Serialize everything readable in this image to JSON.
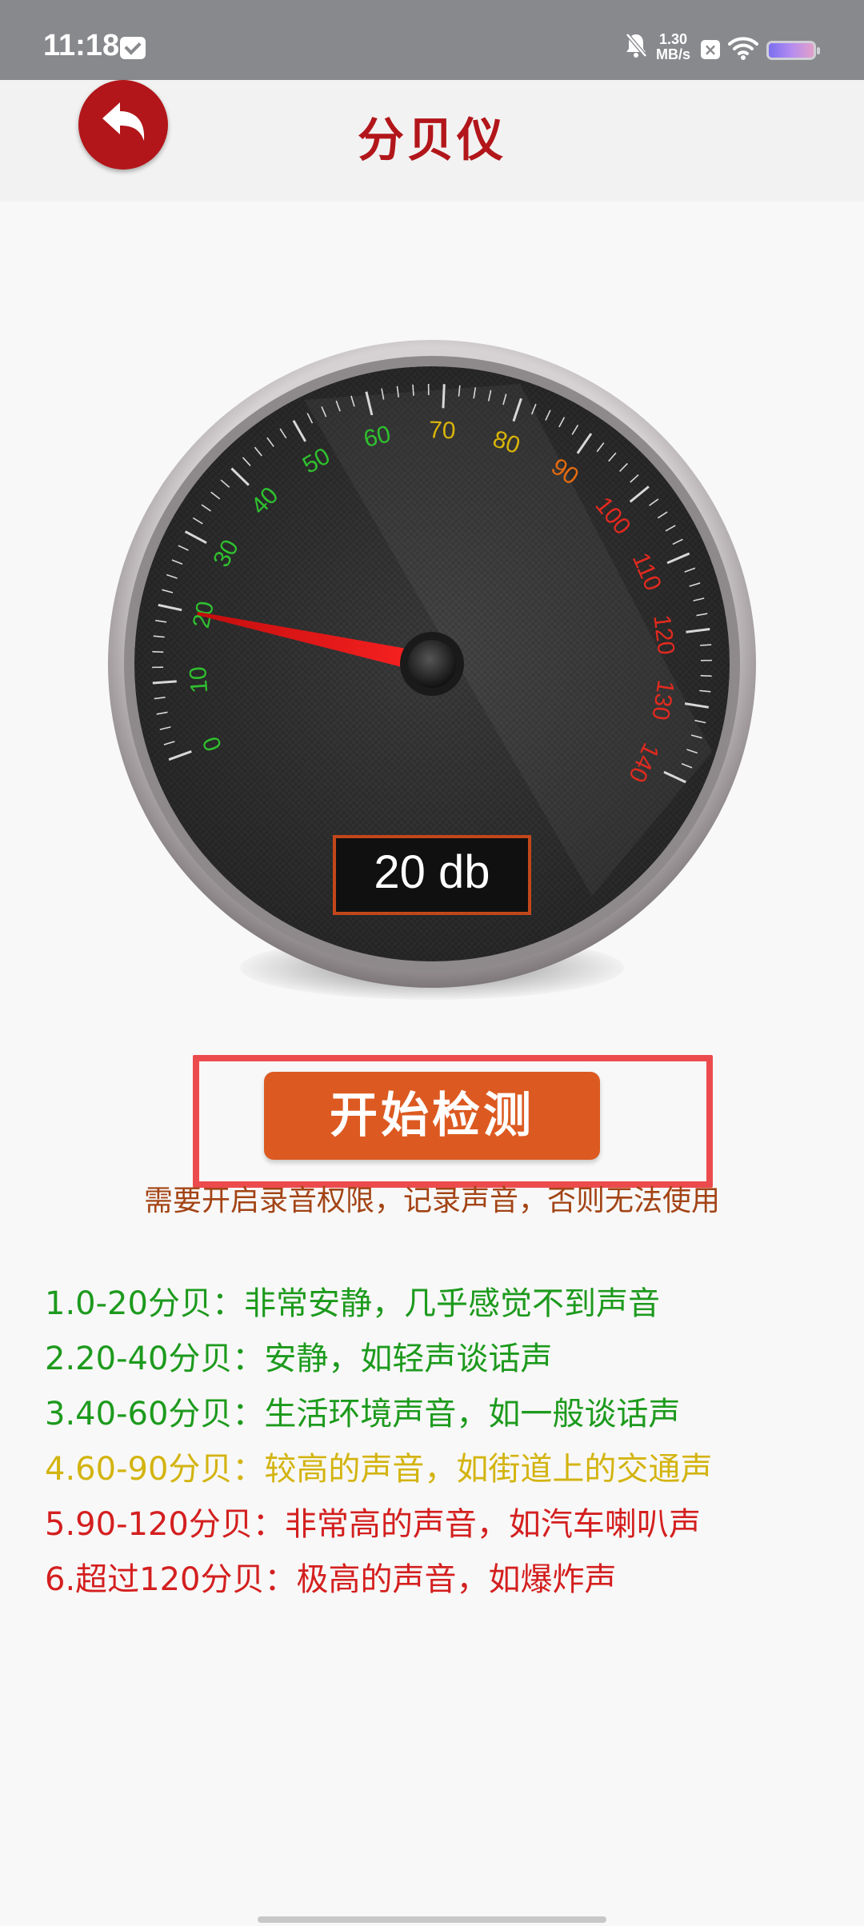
{
  "status_bar": {
    "time": "11:18",
    "net_speed_value": "1.30",
    "net_speed_unit": "MB/s",
    "icons": [
      "message-icon",
      "bell-muted-icon",
      "close-box-icon",
      "wifi-icon",
      "battery-icon"
    ]
  },
  "header": {
    "title": "分贝仪",
    "back_icon": "undo-arrow-icon",
    "accent_color": "#b2161a"
  },
  "gauge": {
    "reading_text": "20 db",
    "value": 20,
    "min": 0,
    "max": 140,
    "ticks": [
      "0",
      "10",
      "20",
      "30",
      "40",
      "50",
      "60",
      "70",
      "80",
      "90",
      "100",
      "110",
      "120",
      "130",
      "140"
    ],
    "tick_colors": {
      "green": "#2fc02f",
      "yellow": "#d9b40a",
      "orange": "#e56a10",
      "red": "#e12a1f"
    }
  },
  "actions": {
    "start_label": "开始检测",
    "start_color": "#dc5a21",
    "permission_note": "需要开启录音权限，记录声音，否则无法使用"
  },
  "levels": [
    {
      "text": "1.0-20分贝：非常安静，几乎感觉不到声音",
      "color": "#1d9a1d"
    },
    {
      "text": "2.20-40分贝：安静，如轻声谈话声",
      "color": "#1d9a1d"
    },
    {
      "text": "3.40-60分贝：生活环境声音，如一般谈话声",
      "color": "#1d9a1d"
    },
    {
      "text": "4.60-90分贝：较高的声音，如街道上的交通声",
      "color": "#d3b410"
    },
    {
      "text": "5.90-120分贝：非常高的声音，如汽车喇叭声",
      "color": "#d41f1f"
    },
    {
      "text": "6.超过120分贝：极高的声音，如爆炸声",
      "color": "#d41f1f"
    }
  ]
}
